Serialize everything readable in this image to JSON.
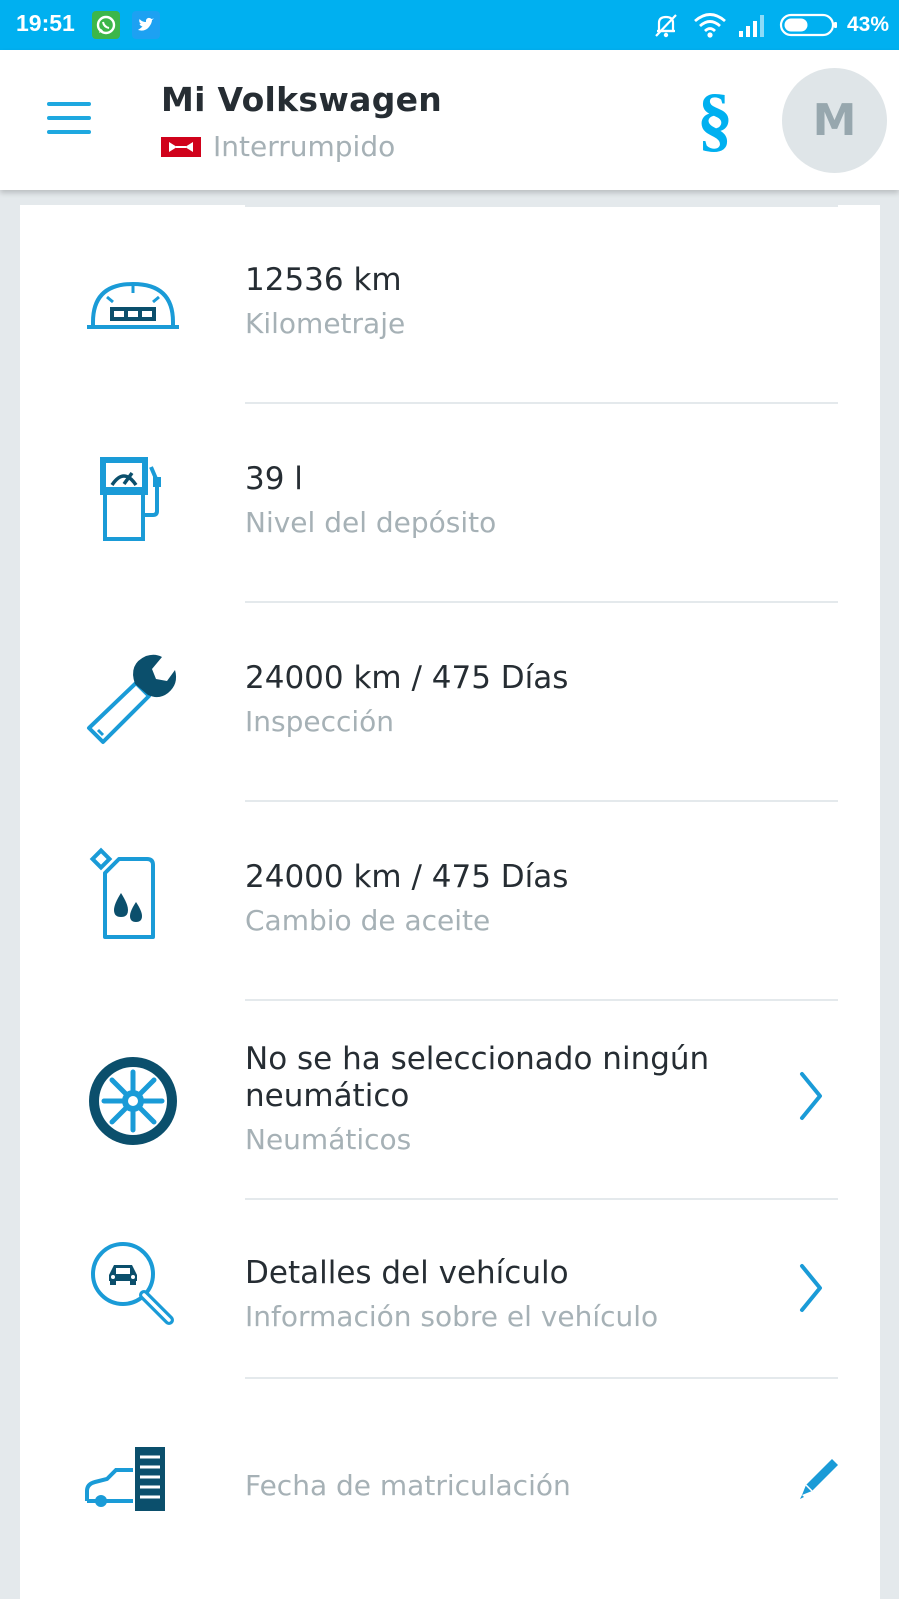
{
  "status_bar": {
    "time": "19:51",
    "battery": "43%",
    "icons": [
      "whatsapp-icon",
      "twitter-icon",
      "alarm-off-icon",
      "wifi-icon",
      "signal-icon",
      "battery-icon"
    ]
  },
  "app_bar": {
    "title": "Mi Volkswagen",
    "status": "Interrumpido",
    "legal_symbol": "§",
    "avatar_initial": "M"
  },
  "items": [
    {
      "value": "12536 km",
      "label": "Kilometraje",
      "icon": "odometer-icon"
    },
    {
      "value": "39 l",
      "label": "Nivel del depósito",
      "icon": "fuel-pump-icon"
    },
    {
      "value": "24000 km / 475 Días",
      "label": "Inspección",
      "icon": "wrench-icon"
    },
    {
      "value": "24000 km / 475 Días",
      "label": "Cambio de aceite",
      "icon": "oil-can-icon"
    },
    {
      "value": "No se ha seleccionado ningún neumático",
      "label": "Neumáticos",
      "icon": "tire-icon",
      "action": "chevron-right-icon"
    },
    {
      "value": "Detalles del vehículo",
      "label": "Información sobre el vehículo",
      "icon": "vehicle-search-icon",
      "action": "chevron-right-icon"
    },
    {
      "value": "",
      "label": "Fecha de matriculación",
      "icon": "registration-icon",
      "action": "pencil-icon"
    }
  ],
  "colors": {
    "accent": "#00b0f0",
    "icon_dark": "#0b4f6c",
    "icon_blue": "#1a9bd7",
    "title_text": "#262d33",
    "secondary_text": "#a6b1b6"
  }
}
